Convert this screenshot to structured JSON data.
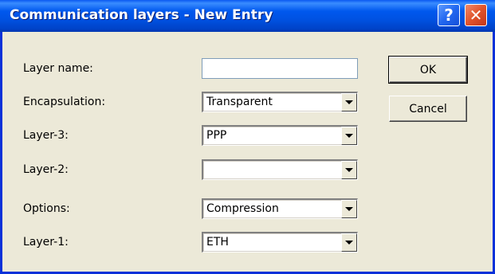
{
  "window": {
    "title": "Communication layers - New Entry",
    "help_glyph": "?",
    "close_glyph": "✕"
  },
  "fields": {
    "layer_name": {
      "label": "Layer name:",
      "value": ""
    },
    "encapsulation": {
      "label": "Encapsulation:",
      "value": "Transparent"
    },
    "layer3": {
      "label": "Layer-3:",
      "value": "PPP"
    },
    "layer2": {
      "label": "Layer-2:",
      "value": ""
    },
    "options": {
      "label": "Options:",
      "value": "Compression"
    },
    "layer1": {
      "label": "Layer-1:",
      "value": "ETH"
    }
  },
  "buttons": {
    "ok": "OK",
    "cancel": "Cancel"
  },
  "icons": {
    "help": "help-icon",
    "close": "close-icon",
    "dropdown": "chevron-down-icon"
  },
  "colors": {
    "title_bar": "#0054E3",
    "window_face": "#ECE9D8",
    "close_button": "#E0532B"
  }
}
